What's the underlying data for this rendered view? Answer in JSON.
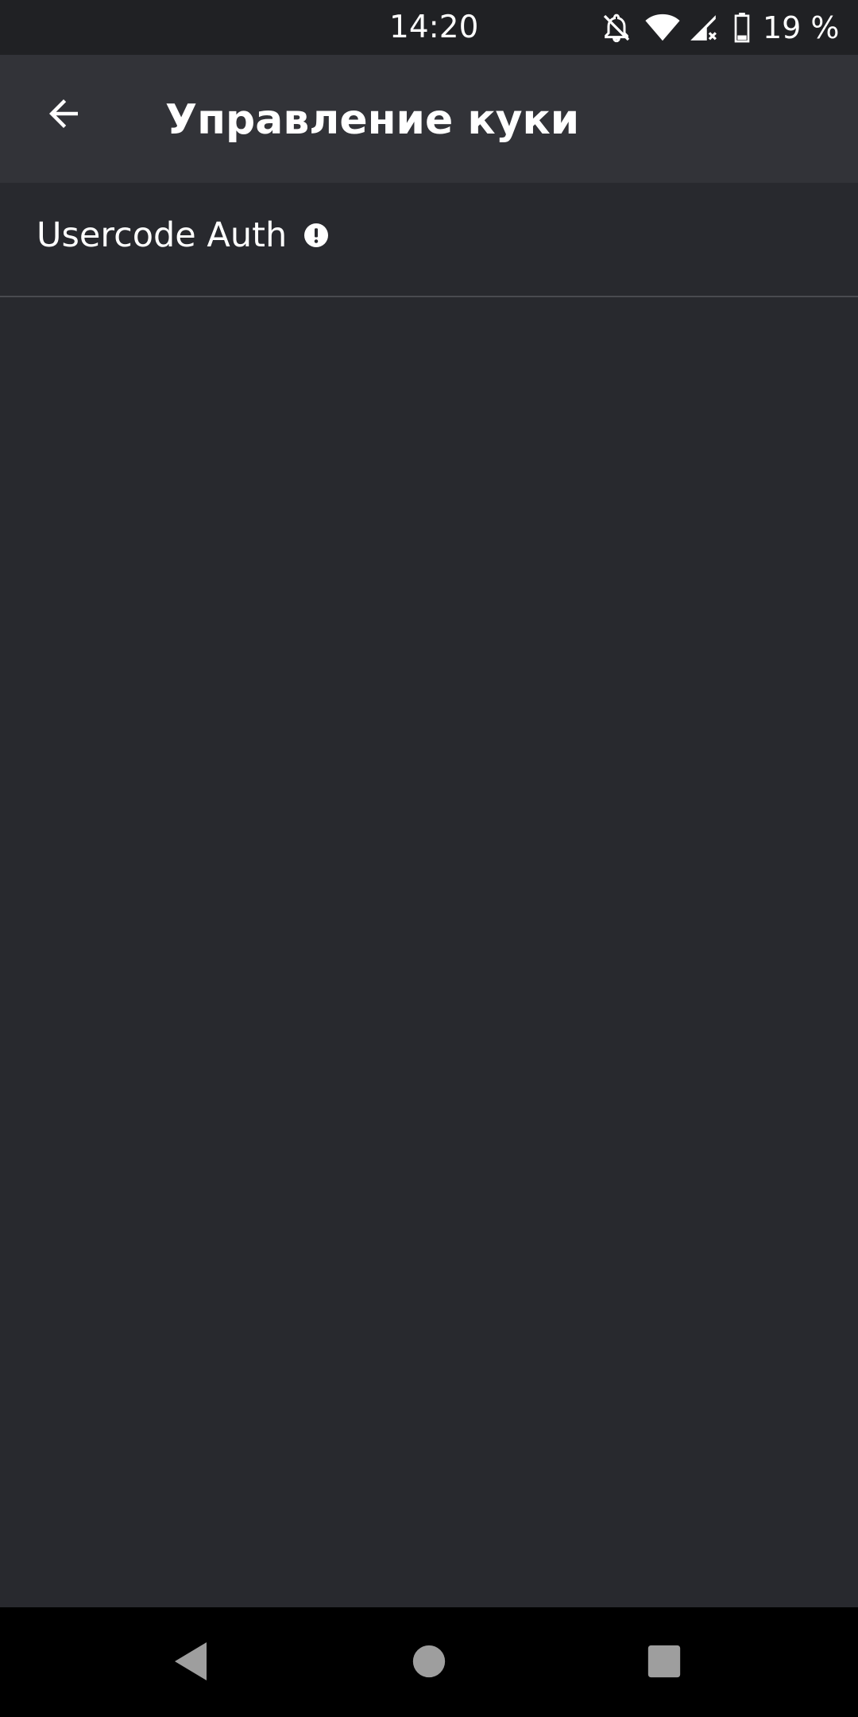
{
  "status_bar": {
    "time": "14:20",
    "battery_percent": "19 %",
    "icons": [
      "notifications-off-icon",
      "wifi-icon",
      "signal-no-data-icon",
      "battery-icon"
    ]
  },
  "toolbar": {
    "title": "Управление куки",
    "back_icon": "arrow-back-icon"
  },
  "list": {
    "items": [
      {
        "label": "Usercode Auth",
        "icon": "info-icon"
      }
    ]
  },
  "nav_bar": {
    "buttons": [
      "back-triangle-icon",
      "home-circle-icon",
      "recents-square-icon"
    ]
  },
  "colors": {
    "background": "#28292e",
    "toolbar": "#323338",
    "status_bar": "#202124",
    "nav_bar": "#000000",
    "text": "#ffffff",
    "nav_icons": "#9e9e9e"
  }
}
